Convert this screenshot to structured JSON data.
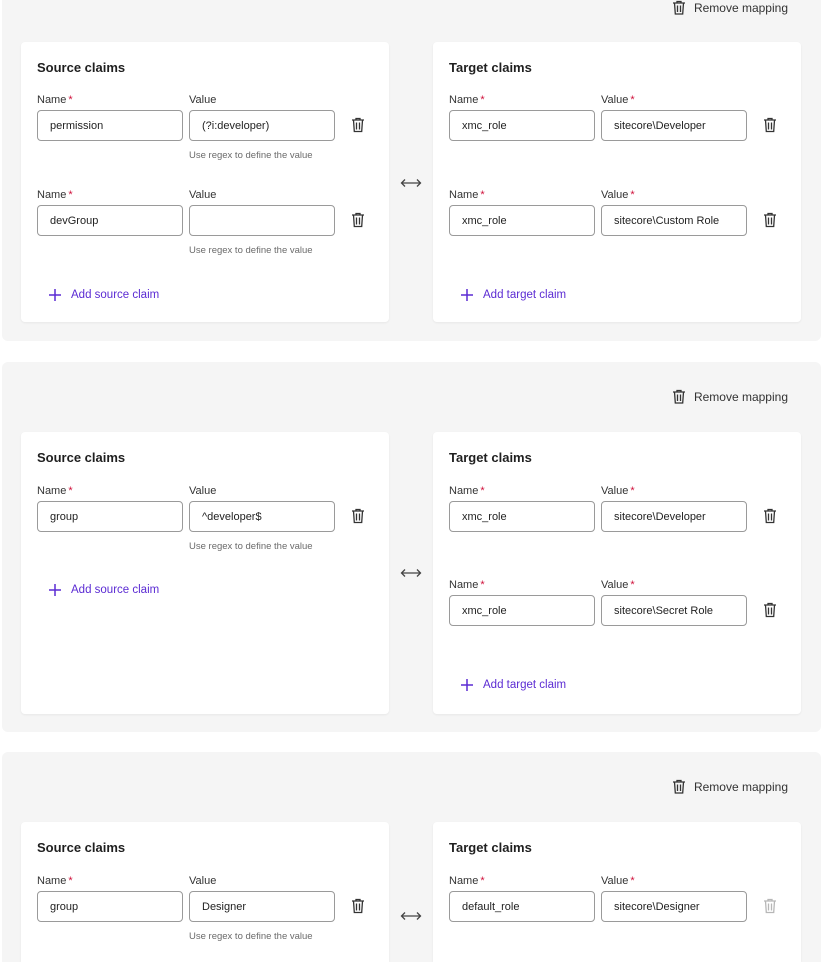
{
  "labels": {
    "source_title": "Source claims",
    "target_title": "Target claims",
    "name": "Name",
    "value": "Value",
    "required_mark": "*",
    "regex_hint": "Use regex to define the value",
    "add_source": "Add source claim",
    "add_target": "Add target claim",
    "remove_mapping": "Remove mapping"
  },
  "mappings": [
    {
      "source": [
        {
          "name": "permission",
          "value": "(?i:developer)"
        },
        {
          "name": "devGroup",
          "value": ""
        }
      ],
      "target": [
        {
          "name": "xmc_role",
          "value": "sitecore\\Developer"
        },
        {
          "name": "xmc_role",
          "value": "sitecore\\Custom Role"
        }
      ]
    },
    {
      "source": [
        {
          "name": "group",
          "value": "^developer$"
        }
      ],
      "target": [
        {
          "name": "xmc_role",
          "value": "sitecore\\Developer"
        },
        {
          "name": "xmc_role",
          "value": "sitecore\\Secret Role"
        }
      ]
    },
    {
      "source": [
        {
          "name": "group",
          "value": "Designer"
        }
      ],
      "target": [
        {
          "name": "default_role",
          "value": "sitecore\\Designer"
        }
      ]
    }
  ],
  "colors": {
    "accent": "#5b2bd3",
    "required": "#d0103a",
    "panel_bg": "#f5f5f5"
  },
  "icons": {
    "trash": "trash-icon",
    "plus": "plus-icon",
    "swap": "swap-arrows-icon"
  }
}
